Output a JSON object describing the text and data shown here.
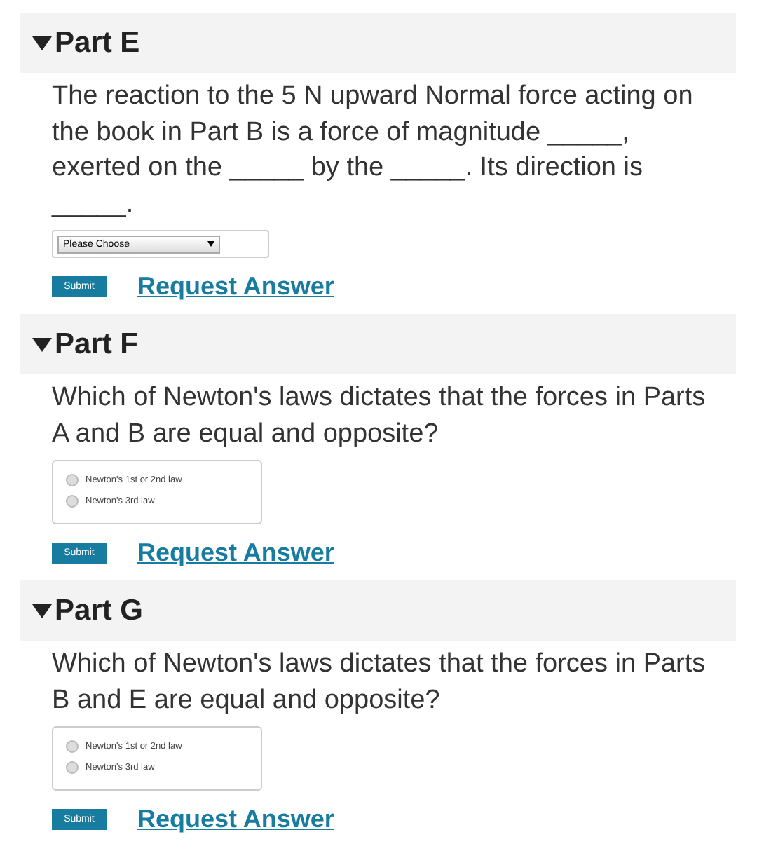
{
  "parts": [
    {
      "title": "Part E",
      "expanded": true,
      "kind": "dropdown",
      "question": "The reaction to the 5 N upward Normal force acting on the book in Part B is a force of magnitude _____, exerted on the _____ by the _____. Its direction is _____.",
      "placeholder": "Please Choose",
      "submit": "Submit",
      "request": "Request Answer"
    },
    {
      "title": "Part F",
      "expanded": true,
      "kind": "radio",
      "question": "Which of Newton's laws dictates that the forces in Parts A and B are equal and opposite?",
      "options": [
        {
          "label": "Newton's 1st or 2nd law",
          "selected": false
        },
        {
          "label": "Newton's 3rd law",
          "selected": false
        }
      ],
      "submit": "Submit",
      "request": "Request Answer"
    },
    {
      "title": "Part G",
      "expanded": true,
      "kind": "radio",
      "question": "Which of Newton's laws dictates that the forces in Parts B and E are equal and opposite?",
      "options": [
        {
          "label": "Newton's 1st or 2nd law",
          "selected": false
        },
        {
          "label": "Newton's 3rd law",
          "selected": false
        }
      ],
      "submit": "Submit",
      "request": "Request Answer"
    }
  ]
}
